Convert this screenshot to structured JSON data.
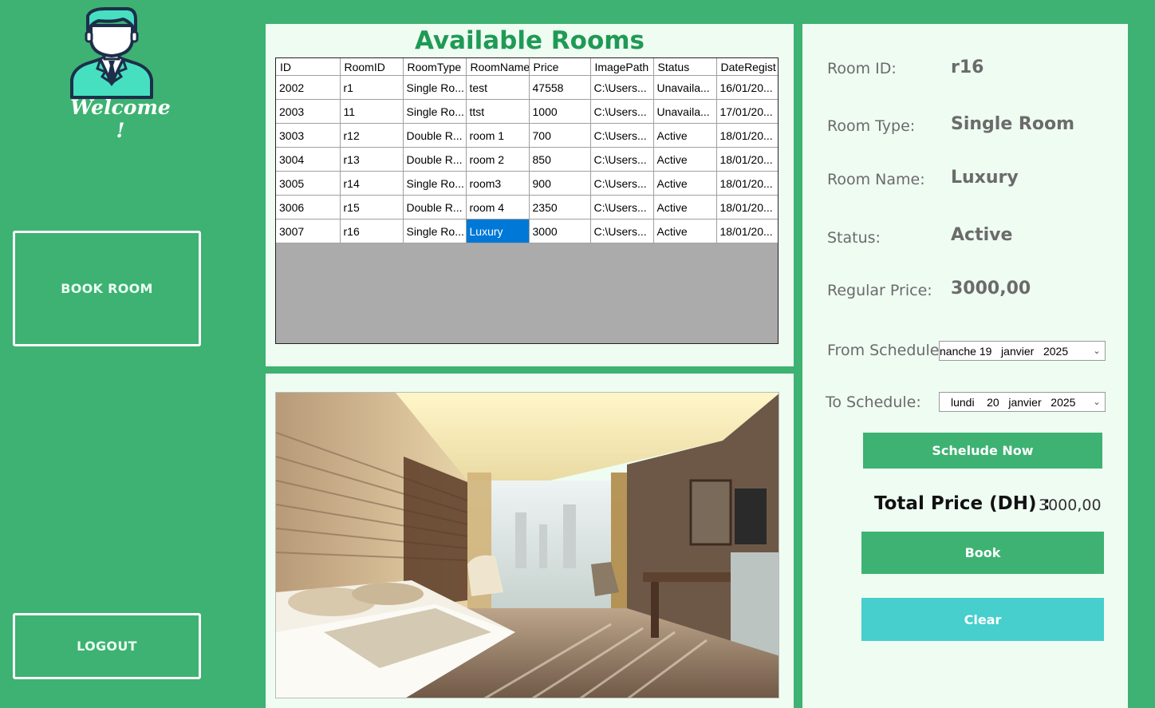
{
  "sidebar": {
    "welcome_text": "Welcome !",
    "book_room_label": "BOOK ROOM",
    "logout_label": "LOGOUT"
  },
  "rooms": {
    "title": "Available Rooms",
    "columns": [
      "ID",
      "RoomID",
      "RoomType",
      "RoomName",
      "Price",
      "ImagePath",
      "Status",
      "DateRegist"
    ],
    "rows": [
      [
        "2002",
        "r1",
        "Single Ro...",
        "test",
        "47558",
        "C:\\Users...",
        "Unavaila...",
        "16/01/20..."
      ],
      [
        "2003",
        "11",
        "Single Ro...",
        "ttst",
        "1000",
        "C:\\Users...",
        "Unavaila...",
        "17/01/20..."
      ],
      [
        "3003",
        "r12",
        "Double R...",
        "room 1",
        "700",
        "C:\\Users...",
        "Active",
        "18/01/20..."
      ],
      [
        "3004",
        "r13",
        "Double R...",
        "room 2",
        "850",
        "C:\\Users...",
        "Active",
        "18/01/20..."
      ],
      [
        "3005",
        "r14",
        "Single Ro...",
        "room3",
        "900",
        "C:\\Users...",
        "Active",
        "18/01/20..."
      ],
      [
        "3006",
        "r15",
        "Double R...",
        "room 4",
        "2350",
        "C:\\Users...",
        "Active",
        "18/01/20..."
      ],
      [
        "3007",
        "r16",
        "Single Ro...",
        "Luxury",
        "3000",
        "C:\\Users...",
        "Active",
        "18/01/20..."
      ]
    ],
    "selected_row": 6,
    "selected_col": 3
  },
  "details": {
    "room_id_label": "Room ID:",
    "room_id_value": "r16",
    "room_type_label": "Room Type:",
    "room_type_value": "Single Room",
    "room_name_label": "Room Name:",
    "room_name_value": "Luxury",
    "status_label": "Status:",
    "status_value": "Active",
    "price_label": "Regular Price:",
    "price_value": "3000,00",
    "from_label": "From Schedule:",
    "from_value": "nanche 19   janvier   2025",
    "to_label": "To  Schedule:",
    "to_value": "lundi    20   janvier   2025",
    "schedule_button": "Schelude Now",
    "total_label": "Total Price (DH) :",
    "total_value": "3000,00",
    "book_button": "Book",
    "clear_button": "Clear"
  },
  "colors": {
    "background": "#3db272",
    "panel": "#effcf2",
    "title": "#1f9a55",
    "clear": "#46cfcc",
    "selection": "#0078d7"
  }
}
